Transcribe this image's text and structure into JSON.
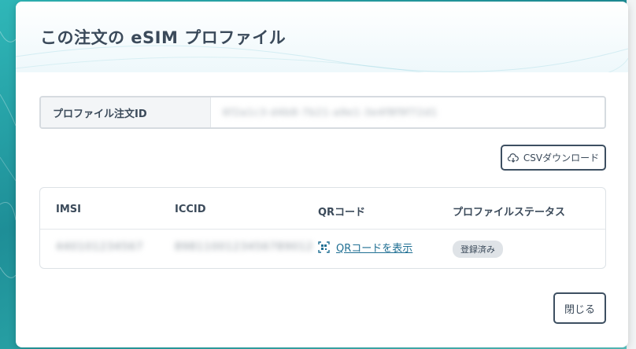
{
  "dialog": {
    "title": "この注文の eSIM プロファイル",
    "profile_id_label": "プロファイル注文ID",
    "profile_id_value": "6f2a1c3-d4b8-7b21-a9e1-3e4f8f9f72d1",
    "csv_button_label": "CSVダウンロード",
    "close_button_label": "閉じる"
  },
  "table": {
    "columns": [
      "IMSI",
      "ICCID",
      "QRコード",
      "プロファイルステータス"
    ],
    "rows": [
      {
        "imsi": "440101234567",
        "iccid": "8981100123456789012",
        "qr_link_label": "QRコードを表示",
        "status": "登録済み"
      }
    ]
  },
  "icons": {
    "csv": "cloud-download-icon",
    "qr": "qr-code-icon"
  },
  "colors": {
    "accent_teal": "#2aa6a8",
    "link": "#1f6f93",
    "text": "#3b4a5a"
  }
}
